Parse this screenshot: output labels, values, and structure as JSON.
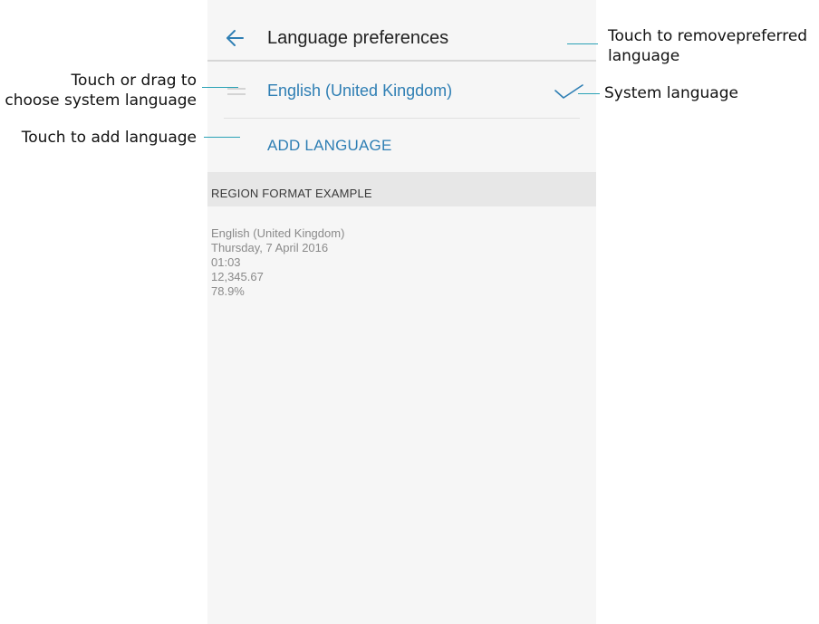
{
  "screen": {
    "title": "Language preferences",
    "back_icon": "arrow-left-icon",
    "language_item": "English (United Kingdom)",
    "drag_icon": "drag-handle-icon",
    "check_icon": "check-icon",
    "add_language_label": "ADD LANGUAGE",
    "region_header": "REGION FORMAT EXAMPLE",
    "region_example": {
      "line1": "English (United Kingdom)",
      "line2": "Thursday, 7 April 2016",
      "line3": "01:03",
      "line4": "12,345.67",
      "line5": "78.9%"
    },
    "accent_color": "#2f7fb4"
  },
  "annotations": {
    "remove_line1": "Touch to removepreferred",
    "remove_line2": "language",
    "drag_line1": "Touch or drag to",
    "drag_line2": "choose system language",
    "system_language": "System language",
    "add_language": "Touch to add language",
    "leader_color": "#2aa2b6"
  }
}
